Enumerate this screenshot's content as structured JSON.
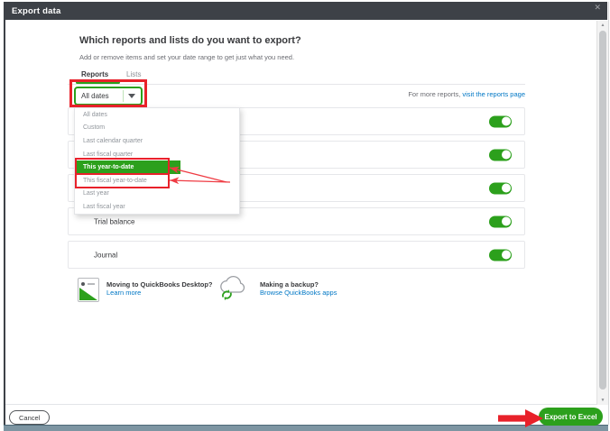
{
  "dialog": {
    "title": "Export data",
    "close_glyph": "✕"
  },
  "header": {
    "heading": "Which reports and lists do you want to export?",
    "subheading": "Add or remove items and set your date range to get just what you need."
  },
  "tabs": {
    "reports": "Reports",
    "lists": "Lists"
  },
  "date_dropdown": {
    "selected": "All dates",
    "options": [
      {
        "label": "All dates"
      },
      {
        "label": "Custom"
      },
      {
        "label": "Last calendar quarter"
      },
      {
        "label": "Last fiscal quarter"
      },
      {
        "label": "This year-to-date",
        "highlighted": true
      },
      {
        "label": "This fiscal year-to-date"
      },
      {
        "label": "Last year"
      },
      {
        "label": "Last fiscal year"
      }
    ]
  },
  "reports_note": {
    "prefix": "For more reports,",
    "link": "visit the reports page"
  },
  "report_rows": [
    {
      "label": "",
      "toggle": "on"
    },
    {
      "label": "",
      "toggle": "on"
    },
    {
      "label": "",
      "toggle": "on"
    },
    {
      "label": "Trial balance",
      "toggle": "on"
    },
    {
      "label": "Journal",
      "toggle": "on"
    }
  ],
  "promos": [
    {
      "title": "Moving to QuickBooks Desktop?",
      "link": "Learn more"
    },
    {
      "title": "Making a backup?",
      "link": "Browse QuickBooks apps"
    }
  ],
  "footer": {
    "cancel": "Cancel",
    "export": "Export to Excel"
  },
  "colors": {
    "accent_green": "#2ca01c",
    "link_blue": "#0077c5",
    "titlebar": "#3d4147",
    "annotation_red": "#e8212a",
    "bottom_strip": "#7d95a2"
  },
  "annotations": {
    "box_1_target": "date-range-dropdown",
    "box_2_target": "year-to-date-options",
    "arrow_targets": [
      "this-year-to-date-option",
      "this-fiscal-year-to-date-option",
      "export-to-excel-button"
    ]
  }
}
